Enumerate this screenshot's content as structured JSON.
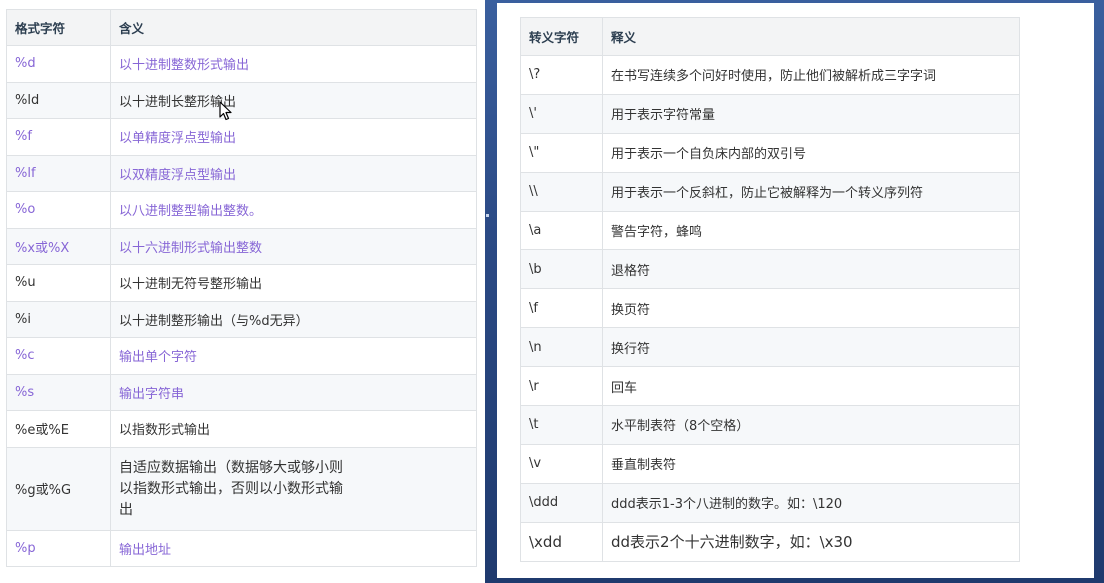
{
  "left_table": {
    "headers": [
      "格式字符",
      "含义"
    ],
    "rows": [
      {
        "code": "%d",
        "meaning": "以十进制整数形式输出",
        "style": "purple"
      },
      {
        "code": "%ld",
        "meaning": "以十进制长整形输出",
        "style": "dark"
      },
      {
        "code": "%f",
        "meaning": "以单精度浮点型输出",
        "style": "purple"
      },
      {
        "code": "%lf",
        "meaning": "以双精度浮点型输出",
        "style": "purple"
      },
      {
        "code": "%o",
        "meaning": "以八进制整型输出整数。",
        "style": "purple"
      },
      {
        "code": "%x或%X",
        "meaning": "以十六进制形式输出整数",
        "style": "purple"
      },
      {
        "code": "%u",
        "meaning": "以十进制无符号整形输出",
        "style": "dark"
      },
      {
        "code": "%i",
        "meaning": "以十进制整形输出（与%d无异）",
        "style": "dark"
      },
      {
        "code": "%c",
        "meaning": "输出单个字符",
        "style": "purple"
      },
      {
        "code": "%s",
        "meaning": "输出字符串",
        "style": "purple"
      },
      {
        "code": "%e或%E",
        "meaning": "以指数形式输出",
        "style": "dark"
      },
      {
        "code": "%g或%G",
        "meaning": "自适应数据输出（数据够大或够小则以指数形式输出，否则以小数形式输出",
        "style": "dark"
      },
      {
        "code": "%p",
        "meaning": "输出地址",
        "style": "purple"
      }
    ]
  },
  "right_table": {
    "headers": [
      "转义字符",
      "释义"
    ],
    "rows": [
      {
        "code": "\\?",
        "meaning": "在书写连续多个问好时使用，防止他们被解析成三字字词"
      },
      {
        "code": "\\'",
        "meaning": "用于表示字符常量"
      },
      {
        "code": "\\\"",
        "meaning": "用于表示一个自负床内部的双引号"
      },
      {
        "code": "\\\\",
        "meaning": "用于表示一个反斜杠，防止它被解释为一个转义序列符"
      },
      {
        "code": "\\a",
        "meaning": "警告字符，蜂鸣"
      },
      {
        "code": "\\b",
        "meaning": "退格符"
      },
      {
        "code": "\\f",
        "meaning": "换页符"
      },
      {
        "code": "\\n",
        "meaning": "换行符"
      },
      {
        "code": "\\r",
        "meaning": "回车"
      },
      {
        "code": "\\t",
        "meaning": "水平制表符（8个空格）"
      },
      {
        "code": "\\v",
        "meaning": "垂直制表符"
      },
      {
        "code": "\\ddd",
        "meaning": "ddd表示1-3个八进制的数字。如：\\120"
      },
      {
        "code": "\\xdd",
        "meaning": "dd表示2个十六进制数字，如：\\x30"
      }
    ]
  },
  "icons": {
    "cursor": "mouse-pointer-icon"
  },
  "colors": {
    "link_purple": "#8766d6",
    "text_dark": "#333333",
    "border": "#dfe2e5",
    "stripe": "#f6f8fa",
    "background_blue": "#2c4f8c"
  }
}
